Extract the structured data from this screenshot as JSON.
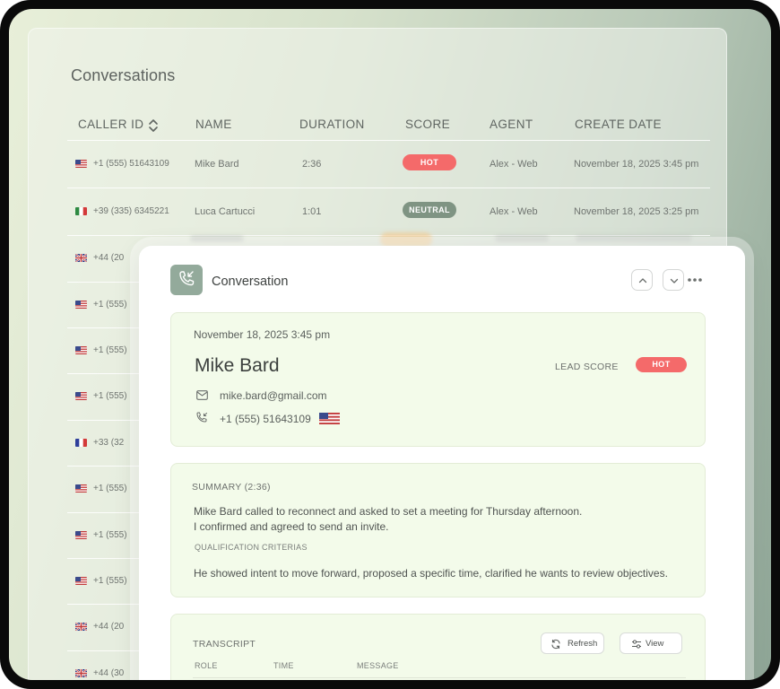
{
  "panel": {
    "title": "Conversations",
    "columns": [
      "CALLER ID",
      "NAME",
      "DURATION",
      "SCORE",
      "AGENT",
      "CREATE DATE"
    ]
  },
  "rows": [
    {
      "flag": "us",
      "caller": "+1 (555) 51643109",
      "name": "Mike Bard",
      "duration": "2:36",
      "score": "HOT",
      "agent": "Alex - Web",
      "date": "November 18, 2025 3:45 pm"
    },
    {
      "flag": "it",
      "caller": "+39 (335) 6345221",
      "name": "Luca Cartucci",
      "duration": "1:01",
      "score": "NEUTRAL",
      "agent": "Alex - Web",
      "date": "November 18, 2025 3:25 pm"
    },
    {
      "flag": "gb",
      "caller": "+44 (20"
    },
    {
      "flag": "us",
      "caller": "+1 (555)"
    },
    {
      "flag": "us",
      "caller": "+1 (555)"
    },
    {
      "flag": "us",
      "caller": "+1 (555)"
    },
    {
      "flag": "fr",
      "caller": "+33 (32"
    },
    {
      "flag": "us",
      "caller": "+1 (555)"
    },
    {
      "flag": "us",
      "caller": "+1 (555)"
    },
    {
      "flag": "us",
      "caller": "+1 (555)"
    },
    {
      "flag": "gb",
      "caller": "+44 (20"
    },
    {
      "flag": "gb",
      "caller": "+44 (30"
    }
  ],
  "colors": {
    "hot": "#f46a6a",
    "neutral": "#7f9483",
    "accent": "#93aa9b",
    "section_bg": "#f3fbea"
  },
  "detail": {
    "title": "Conversation",
    "date": "November 18, 2025 3:45 pm",
    "name": "Mike Bard",
    "lead_score_label": "LEAD SCORE",
    "lead_score": "HOT",
    "email": "mike.bard@gmail.com",
    "phone": "+1 (555) 51643109",
    "summary_label": "SUMMARY (2:36)",
    "summary_line1": "Mike Bard called to reconnect and asked to set a meeting for Thursday afternoon.",
    "summary_line2": "I confirmed and agreed to send an invite.",
    "criteria_label": "QUALIFICATION CRITERIAS",
    "criteria_text": "He showed intent to move forward, proposed a specific time, clarified he wants to review objectives.",
    "transcript_label": "TRANSCRIPT",
    "refresh_label": "Refresh",
    "view_label": "View",
    "transcript_columns": [
      "ROLE",
      "TIME",
      "MESSAGE"
    ]
  }
}
